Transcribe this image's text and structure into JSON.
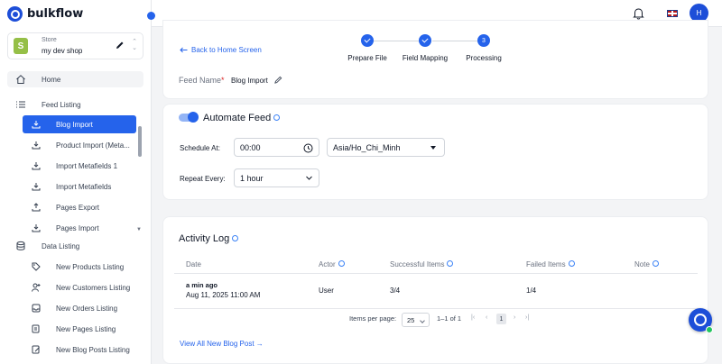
{
  "app": {
    "name": "bulkflow"
  },
  "store": {
    "label": "Store",
    "name": "my dev shop"
  },
  "sidebar": {
    "home": "Home",
    "feed_listing": "Feed Listing",
    "feed_items": [
      {
        "label": "Blog Import",
        "icon": "download-icon"
      },
      {
        "label": "Product Import (Meta...",
        "icon": "download-icon"
      },
      {
        "label": "Import Metafields 1",
        "icon": "download-icon"
      },
      {
        "label": "Import Metafields",
        "icon": "download-icon"
      },
      {
        "label": "Pages Export",
        "icon": "upload-icon"
      },
      {
        "label": "Pages Import",
        "icon": "download-icon"
      }
    ],
    "data_listing": "Data Listing",
    "data_items": [
      {
        "label": "New Products Listing",
        "icon": "tag-icon"
      },
      {
        "label": "New Customers Listing",
        "icon": "user-plus-icon"
      },
      {
        "label": "New Orders Listing",
        "icon": "inbox-icon"
      },
      {
        "label": "New Pages Listing",
        "icon": "pages-icon"
      },
      {
        "label": "New Blog Posts Listing",
        "icon": "blog-edit-icon"
      }
    ]
  },
  "topbar": {
    "avatar_initial": "H"
  },
  "header": {
    "back_link": "Back to Home Screen",
    "steps": [
      {
        "label": "Prepare File",
        "state": "done"
      },
      {
        "label": "Field Mapping",
        "state": "done"
      },
      {
        "label": "Processing",
        "state": "current",
        "number": "3"
      }
    ],
    "feed_name_label": "Feed Name",
    "feed_name_required": "*",
    "feed_name_value": "Blog Import"
  },
  "automate": {
    "title": "Automate Feed",
    "enabled": true,
    "schedule_label": "Schedule At:",
    "schedule_time": "00:00",
    "timezone": "Asia/Ho_Chi_Minh",
    "repeat_label": "Repeat Every:",
    "repeat_value": "1 hour"
  },
  "activity": {
    "title": "Activity Log",
    "columns": [
      "Date",
      "Actor",
      "Successful Items",
      "Failed Items",
      "Note"
    ],
    "rows": [
      {
        "relative": "a min ago",
        "date": "Aug 11, 2025 11:00 AM",
        "actor": "User",
        "successful": "3/4",
        "failed": "1/4",
        "note": ""
      }
    ],
    "pagination": {
      "per_page_label": "Items per page:",
      "per_page": "25",
      "range": "1–1 of 1",
      "current_page": "1"
    },
    "view_all": "View All New Blog Post"
  },
  "colors": {
    "accent": "#2563eb",
    "brand": "#1d4ed8"
  }
}
